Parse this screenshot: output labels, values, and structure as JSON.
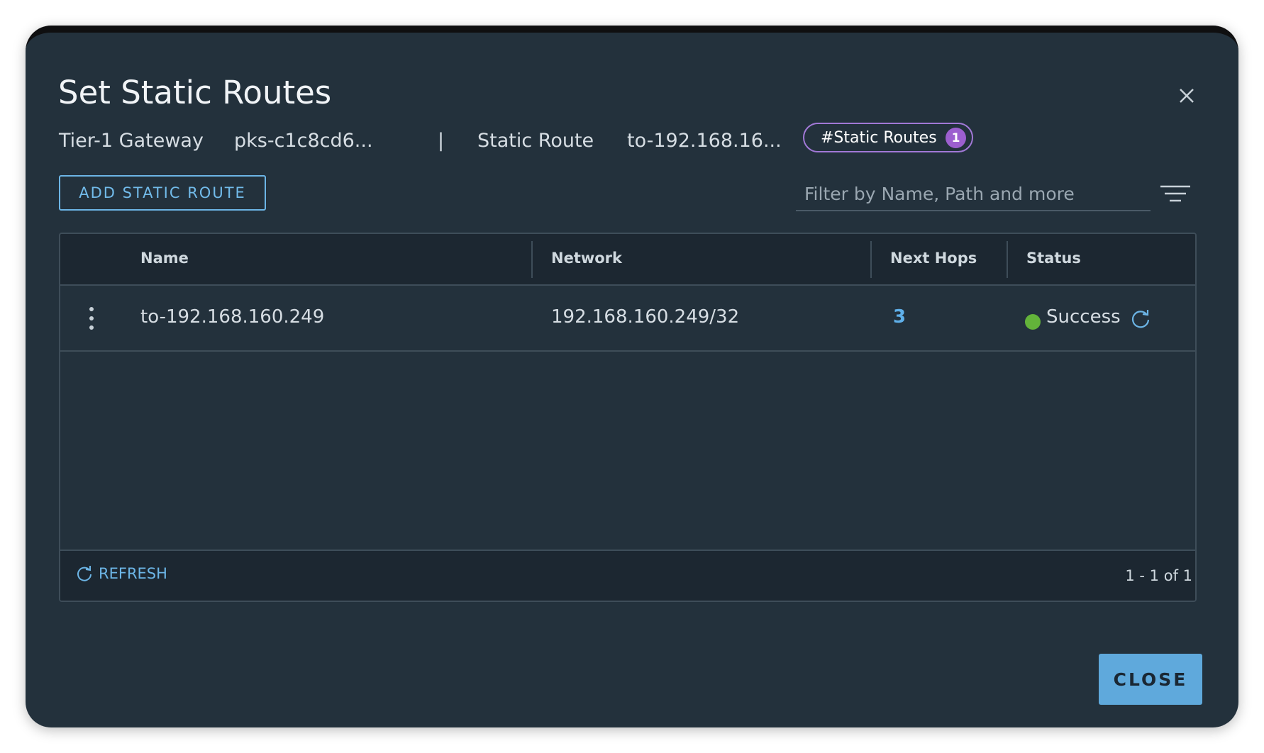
{
  "dialog": {
    "title": "Set Static Routes",
    "close_icon": "close-icon"
  },
  "context": {
    "gateway_label": "Tier-1 Gateway",
    "gateway_value": "pks-c1c8cd6...",
    "separator": "|",
    "route_label": "Static Route",
    "route_value": "to-192.168.16...",
    "tag_label": "#Static Routes",
    "tag_count": "1"
  },
  "toolbar": {
    "add_label": "ADD STATIC ROUTE",
    "filter_placeholder": "Filter by Name, Path and more",
    "filter_icon": "filter-icon"
  },
  "table": {
    "columns": [
      "Name",
      "Network",
      "Next Hops",
      "Status"
    ],
    "rows": [
      {
        "name": "to-192.168.160.249",
        "network": "192.168.160.249/32",
        "next_hops": "3",
        "status": "Success"
      }
    ],
    "footer": {
      "refresh_label": "REFRESH",
      "pagination": "1 - 1 of 1"
    }
  },
  "actions": {
    "close_label": "CLOSE"
  },
  "colors": {
    "modal_bg": "#23313c",
    "accent_blue": "#5fa9dc",
    "tag_purple": "#a178d6",
    "success_green": "#63b33a"
  }
}
